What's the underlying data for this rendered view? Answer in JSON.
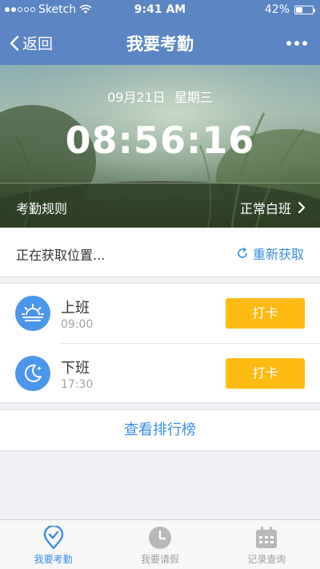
{
  "status_bar": {
    "carrier": "Sketch",
    "time": "9:41 AM",
    "battery": "42%",
    "battery_level": 0.42
  },
  "nav": {
    "back_label": "返回",
    "title": "我要考勤"
  },
  "hero": {
    "date": "09月21日",
    "weekday": "星期三",
    "clock": "08:56:16"
  },
  "rule": {
    "label": "考勤规则",
    "value": "正常白班"
  },
  "location": {
    "status": "正在获取位置...",
    "refresh": "重新获取"
  },
  "shifts": [
    {
      "name": "上班",
      "time": "09:00",
      "button": "打卡",
      "icon": "sunrise-icon"
    },
    {
      "name": "下班",
      "time": "17:30",
      "button": "打卡",
      "icon": "moon-icon"
    }
  ],
  "rank": {
    "label": "查看排行榜"
  },
  "tabs": [
    {
      "label": "我要考勤",
      "icon": "location-check-icon",
      "active": true
    },
    {
      "label": "我要请假",
      "icon": "clock-icon",
      "active": false
    },
    {
      "label": "记录查询",
      "icon": "calendar-icon",
      "active": false
    }
  ],
  "colors": {
    "accent": "#3a8ee6",
    "button": "#fdbb14",
    "icon_bg": "#4b97ec",
    "nav_bg": "#5a86c4"
  }
}
